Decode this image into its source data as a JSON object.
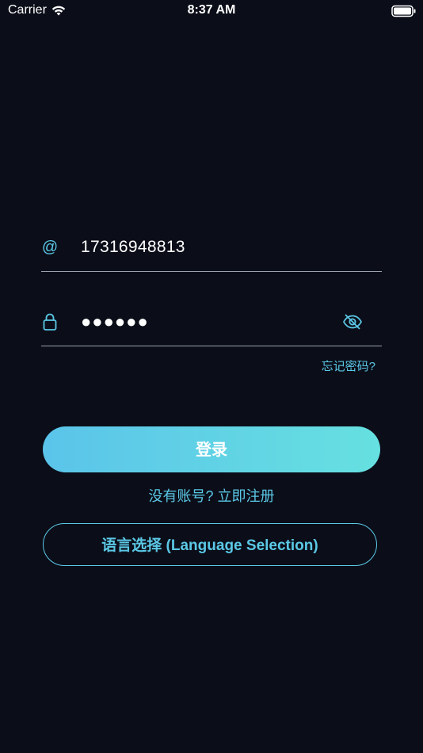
{
  "status_bar": {
    "carrier": "Carrier",
    "time": "8:37 AM"
  },
  "login_form": {
    "phone_value": "17316948813",
    "password_masked": "●●●●●●",
    "forgot_password": "忘记密码?",
    "login_button": "登录",
    "register_link": "没有账号? 立即注册",
    "language_button": "语言选择 (Language Selection)"
  },
  "icons": {
    "field_email": "at-icon",
    "field_password": "lock-icon",
    "password_toggle": "eye-slash-icon",
    "status_wifi": "wifi-icon",
    "status_battery": "battery-icon"
  },
  "colors": {
    "background": "#0b0e19",
    "accent": "#5bc8e6",
    "gradient_start": "#5bc4ea",
    "gradient_end": "#66e0e0",
    "divider": "#9aa0ad"
  }
}
